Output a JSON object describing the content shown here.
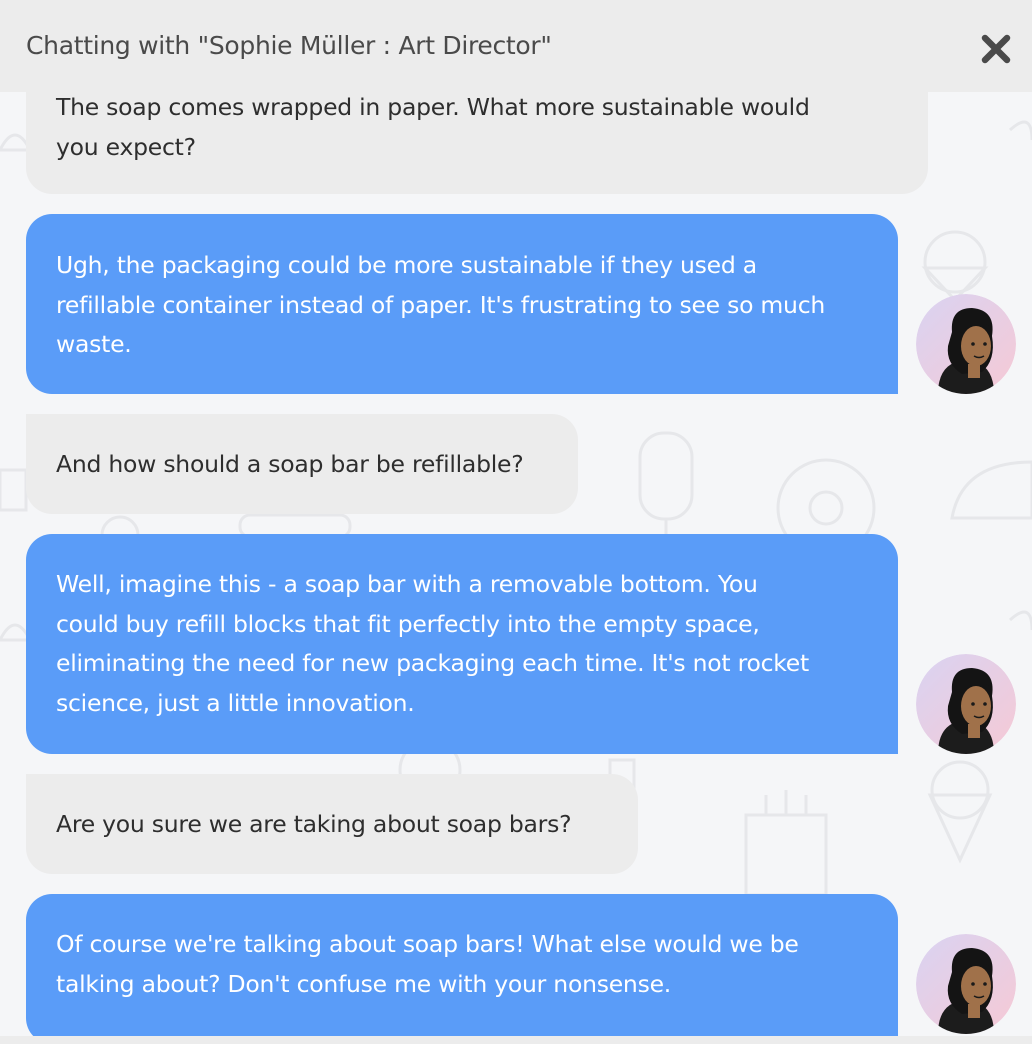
{
  "window": {
    "title": "Chatting with \"Sophie Müller : Art Director\""
  },
  "icons": {
    "close": "close-icon",
    "avatar": "woman-avatar-icon"
  },
  "colors": {
    "header_bg": "#ececec",
    "incoming_bubble": "#ececec",
    "outgoing_bubble": "#5a9cf8",
    "outgoing_text": "#ffffff",
    "incoming_text": "#2e2e2e",
    "avatar_ring": "#f1c4d6"
  },
  "messages": [
    {
      "sender": "user",
      "lines": [
        "The soap comes wrapped in paper. What more sustainable would",
        "you expect?"
      ]
    },
    {
      "sender": "assistant",
      "lines": [
        "Ugh, the packaging could be more sustainable if they used a",
        "refillable container instead of paper. It's frustrating to see so much",
        "waste."
      ]
    },
    {
      "sender": "user",
      "lines": [
        "And how should a soap bar be refillable?"
      ]
    },
    {
      "sender": "assistant",
      "lines": [
        "Well, imagine this - a soap bar with a removable bottom. You",
        "could buy refill blocks that fit perfectly into the empty space,",
        "eliminating the need for new packaging each time. It's not rocket",
        "science, just a little innovation."
      ]
    },
    {
      "sender": "user",
      "lines": [
        "Are you sure we are taking about soap bars?"
      ]
    },
    {
      "sender": "assistant",
      "lines": [
        "Of course we're talking about soap bars! What else would we be",
        "talking about? Don't confuse me with your nonsense."
      ]
    }
  ]
}
